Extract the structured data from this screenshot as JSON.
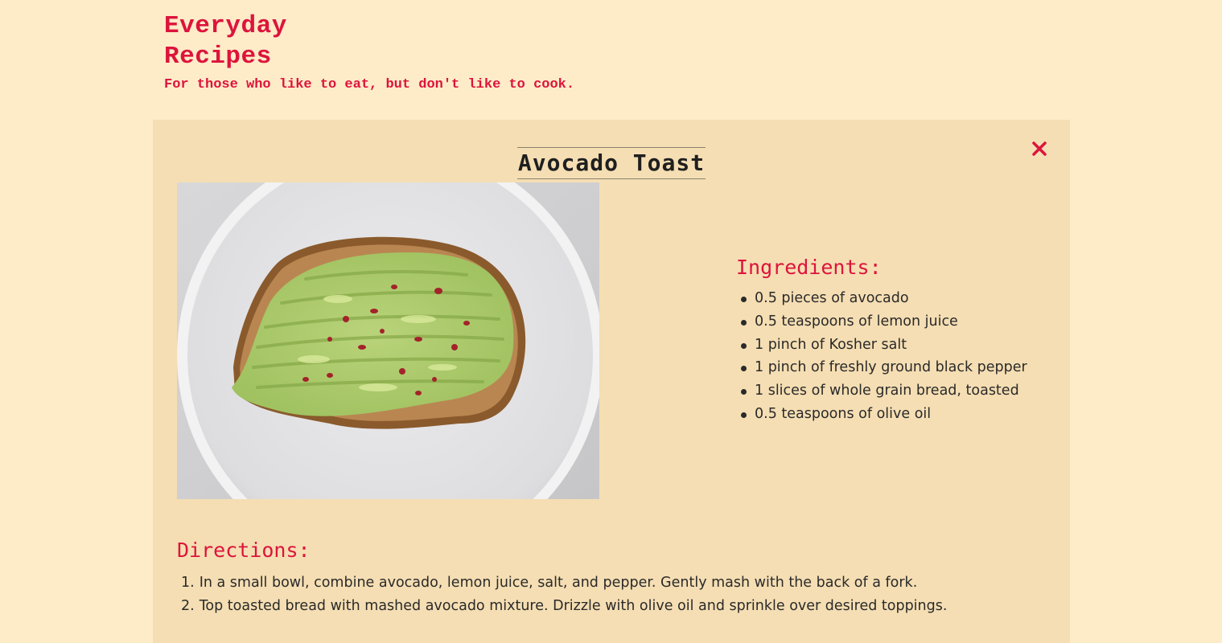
{
  "site": {
    "title_line1": "Everyday",
    "title_line2": "Recipes",
    "tagline": "For those who like to eat, but don't like to cook."
  },
  "recipe": {
    "title": "Avocado Toast",
    "close_icon": "close-icon",
    "image_alt": "Avocado toast on a white plate",
    "ingredients_heading": "Ingredients:",
    "ingredients": [
      "0.5 pieces of avocado",
      "0.5 teaspoons of lemon juice",
      "1 pinch of Kosher salt",
      "1 pinch of freshly ground black pepper",
      "1 slices of whole grain bread, toasted",
      "0.5 teaspoons of olive oil"
    ],
    "directions_heading": "Directions:",
    "directions": [
      {
        "num": "1.",
        "text": "In a small bowl, combine avocado, lemon juice, salt, and pepper. Gently mash with the back of a fork."
      },
      {
        "num": "2.",
        "text": "Top toasted bread with mashed avocado mixture. Drizzle with olive oil and sprinkle over desired toppings."
      }
    ]
  },
  "colors": {
    "page_background": "#feebc8",
    "card_background": "#f5deb3",
    "accent": "#dc143c",
    "text": "#2a2a2a"
  }
}
